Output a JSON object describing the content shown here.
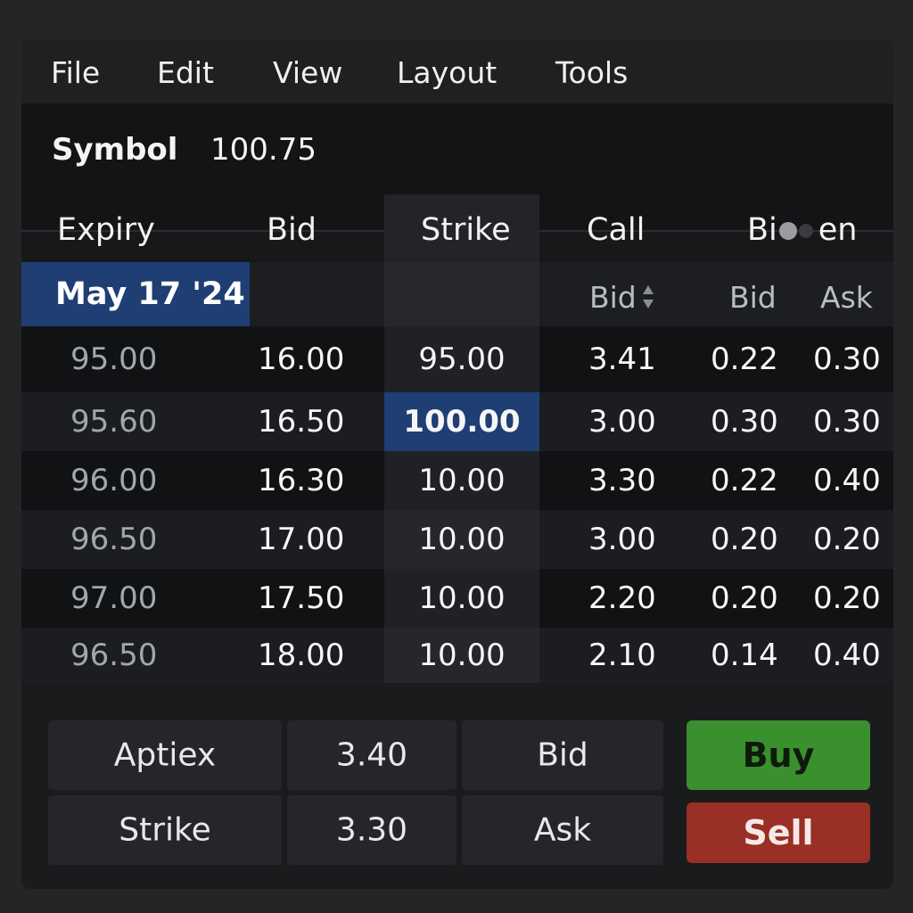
{
  "menu": {
    "items": [
      "File",
      "Edit",
      "View",
      "Layout",
      "Tools"
    ]
  },
  "symbol": {
    "label": "Symbol",
    "value": "100.75"
  },
  "table": {
    "headers": {
      "expiry": "Expiry",
      "bid": "Bid",
      "strike": "Strike",
      "call": "Call",
      "extra_prefix": "Bi",
      "extra_suffix": "en"
    },
    "selected_expiry": "May 17 '24",
    "subheaders": {
      "call_bid": "Bid",
      "bid": "Bid",
      "ask": "Ask"
    },
    "rows": [
      {
        "expiry": "95.00",
        "bid": "16.00",
        "strike": "95.00",
        "call_bid": "3.41",
        "bid2": "0.22",
        "ask": "0.30"
      },
      {
        "expiry": "95.60",
        "bid": "16.50",
        "strike": "100.00",
        "call_bid": "3.00",
        "bid2": "0.30",
        "ask": "0.30"
      },
      {
        "expiry": "96.00",
        "bid": "16.30",
        "strike": "10.00",
        "call_bid": "3.30",
        "bid2": "0.22",
        "ask": "0.40"
      },
      {
        "expiry": "96.50",
        "bid": "17.00",
        "strike": "10.00",
        "call_bid": "3.00",
        "bid2": "0.20",
        "ask": "0.20"
      },
      {
        "expiry": "97.00",
        "bid": "17.50",
        "strike": "10.00",
        "call_bid": "2.20",
        "bid2": "0.20",
        "ask": "0.20"
      },
      {
        "expiry": "96.50",
        "bid": "18.00",
        "strike": "10.00",
        "call_bid": "2.10",
        "bid2": "0.14",
        "ask": "0.40"
      }
    ],
    "selected_strike_row": 1
  },
  "order_panel": {
    "row1": {
      "label": "Aptiex",
      "value": "3.40",
      "side": "Bid"
    },
    "row2": {
      "label": "Strike",
      "value": "3.30",
      "side": "Ask"
    },
    "buy_label": "Buy",
    "sell_label": "Sell"
  },
  "colors": {
    "selection": "#1f3e74",
    "buy": "#3a8f2f",
    "sell": "#9a2f25"
  },
  "icons": {
    "sort": "sort-arrows-icon"
  }
}
